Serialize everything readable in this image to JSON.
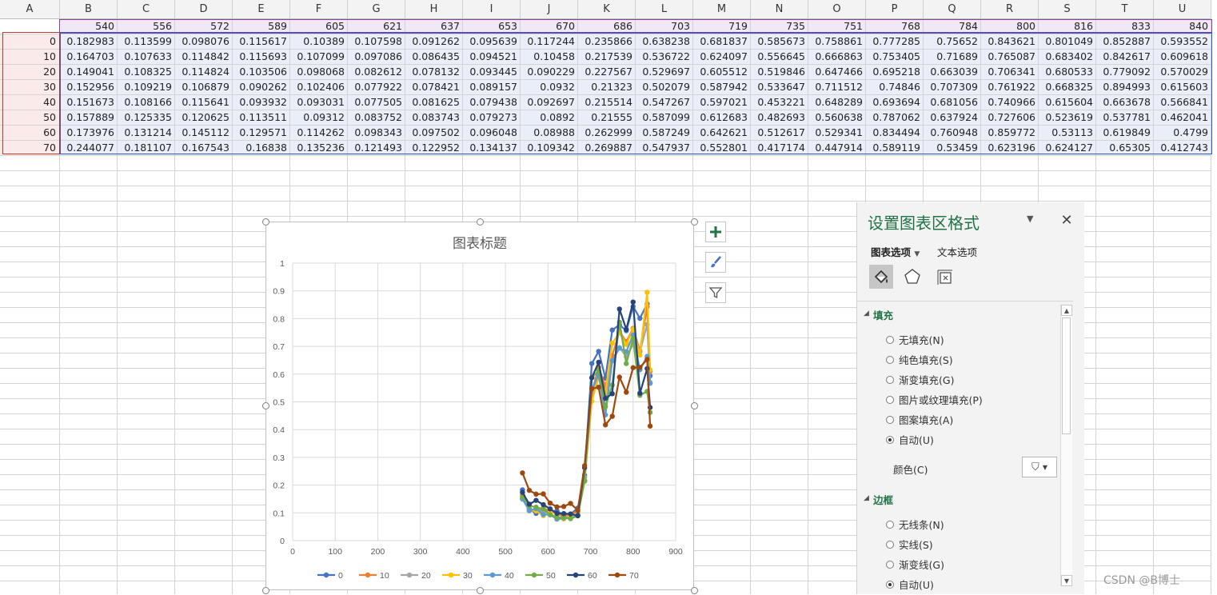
{
  "columns": [
    "A",
    "B",
    "C",
    "D",
    "E",
    "F",
    "G",
    "H",
    "I",
    "J",
    "K",
    "L",
    "M",
    "N",
    "O",
    "P",
    "Q",
    "R",
    "S",
    "T",
    "U"
  ],
  "x_header": [
    "540",
    "556",
    "572",
    "589",
    "605",
    "621",
    "637",
    "653",
    "670",
    "686",
    "703",
    "719",
    "735",
    "751",
    "768",
    "784",
    "800",
    "816",
    "833",
    "840"
  ],
  "rows": [
    {
      "label": "0",
      "values": [
        "0.182983",
        "0.113599",
        "0.098076",
        "0.115617",
        "0.10389",
        "0.107598",
        "0.091262",
        "0.095639",
        "0.117244",
        "0.235866",
        "0.638238",
        "0.681837",
        "0.585673",
        "0.758861",
        "0.777285",
        "0.75652",
        "0.843621",
        "0.801049",
        "0.852887",
        "0.593552"
      ]
    },
    {
      "label": "10",
      "values": [
        "0.164703",
        "0.107633",
        "0.114842",
        "0.115693",
        "0.107099",
        "0.097086",
        "0.086435",
        "0.094521",
        "0.10458",
        "0.217539",
        "0.536722",
        "0.624097",
        "0.556645",
        "0.666863",
        "0.753405",
        "0.71689",
        "0.765087",
        "0.683402",
        "0.842617",
        "0.609618"
      ]
    },
    {
      "label": "20",
      "values": [
        "0.149041",
        "0.108325",
        "0.114824",
        "0.103506",
        "0.098068",
        "0.082612",
        "0.078132",
        "0.093445",
        "0.090229",
        "0.227567",
        "0.529697",
        "0.605512",
        "0.519846",
        "0.647466",
        "0.695218",
        "0.663039",
        "0.706341",
        "0.680533",
        "0.779092",
        "0.570029"
      ]
    },
    {
      "label": "30",
      "values": [
        "0.152956",
        "0.109219",
        "0.106879",
        "0.090262",
        "0.102406",
        "0.077922",
        "0.078421",
        "0.089157",
        "0.0932",
        "0.21323",
        "0.502079",
        "0.587942",
        "0.533647",
        "0.711512",
        "0.74846",
        "0.707309",
        "0.761922",
        "0.668325",
        "0.894993",
        "0.615603"
      ]
    },
    {
      "label": "40",
      "values": [
        "0.151673",
        "0.108166",
        "0.115641",
        "0.093932",
        "0.093031",
        "0.077505",
        "0.081625",
        "0.079438",
        "0.092697",
        "0.215514",
        "0.547267",
        "0.597021",
        "0.453221",
        "0.648289",
        "0.693694",
        "0.681056",
        "0.740966",
        "0.615604",
        "0.663678",
        "0.566841"
      ]
    },
    {
      "label": "50",
      "values": [
        "0.157889",
        "0.125335",
        "0.120625",
        "0.113511",
        "0.09312",
        "0.083752",
        "0.083743",
        "0.079273",
        "0.0892",
        "0.21555",
        "0.587099",
        "0.612683",
        "0.482693",
        "0.560638",
        "0.787062",
        "0.637924",
        "0.727606",
        "0.523619",
        "0.537781",
        "0.462041"
      ]
    },
    {
      "label": "60",
      "values": [
        "0.173976",
        "0.131214",
        "0.145112",
        "0.129571",
        "0.114262",
        "0.098343",
        "0.097502",
        "0.096048",
        "0.08988",
        "0.262999",
        "0.587249",
        "0.642621",
        "0.512617",
        "0.529341",
        "0.834494",
        "0.760948",
        "0.859772",
        "0.53113",
        "0.619849",
        "0.4799"
      ]
    },
    {
      "label": "70",
      "values": [
        "0.244077",
        "0.181107",
        "0.167543",
        "0.16838",
        "0.135236",
        "0.121493",
        "0.122952",
        "0.134137",
        "0.109342",
        "0.269887",
        "0.547937",
        "0.552801",
        "0.417174",
        "0.447914",
        "0.589119",
        "0.53459",
        "0.623196",
        "0.624127",
        "0.65305",
        "0.412743"
      ]
    }
  ],
  "chart_data": {
    "type": "scatter",
    "title": "图表标题",
    "xlim": [
      0,
      900
    ],
    "ylim": [
      0,
      1
    ],
    "xticks": [
      "0",
      "100",
      "200",
      "300",
      "400",
      "500",
      "600",
      "700",
      "800",
      "900"
    ],
    "yticks": [
      "0",
      "0.1",
      "0.2",
      "0.3",
      "0.4",
      "0.5",
      "0.6",
      "0.7",
      "0.8",
      "0.9",
      "1"
    ],
    "x": [
      540,
      556,
      572,
      589,
      605,
      621,
      637,
      653,
      670,
      686,
      703,
      719,
      735,
      751,
      768,
      784,
      800,
      816,
      833,
      840
    ],
    "grid": true,
    "legend_position": "bottom",
    "series": [
      {
        "name": "0",
        "color": "#4472c4",
        "values": [
          0.182983,
          0.113599,
          0.098076,
          0.115617,
          0.10389,
          0.107598,
          0.091262,
          0.095639,
          0.117244,
          0.235866,
          0.638238,
          0.681837,
          0.585673,
          0.758861,
          0.777285,
          0.75652,
          0.843621,
          0.801049,
          0.852887,
          0.593552
        ]
      },
      {
        "name": "10",
        "color": "#ed7d31",
        "values": [
          0.164703,
          0.107633,
          0.114842,
          0.115693,
          0.107099,
          0.097086,
          0.086435,
          0.094521,
          0.10458,
          0.217539,
          0.536722,
          0.624097,
          0.556645,
          0.666863,
          0.753405,
          0.71689,
          0.765087,
          0.683402,
          0.842617,
          0.609618
        ]
      },
      {
        "name": "20",
        "color": "#a5a5a5",
        "values": [
          0.149041,
          0.108325,
          0.114824,
          0.103506,
          0.098068,
          0.082612,
          0.078132,
          0.093445,
          0.090229,
          0.227567,
          0.529697,
          0.605512,
          0.519846,
          0.647466,
          0.695218,
          0.663039,
          0.706341,
          0.680533,
          0.779092,
          0.570029
        ]
      },
      {
        "name": "30",
        "color": "#ffc000",
        "values": [
          0.152956,
          0.109219,
          0.106879,
          0.090262,
          0.102406,
          0.077922,
          0.078421,
          0.089157,
          0.0932,
          0.21323,
          0.502079,
          0.587942,
          0.533647,
          0.711512,
          0.74846,
          0.707309,
          0.761922,
          0.668325,
          0.894993,
          0.615603
        ]
      },
      {
        "name": "40",
        "color": "#5b9bd5",
        "values": [
          0.151673,
          0.108166,
          0.115641,
          0.093932,
          0.093031,
          0.077505,
          0.081625,
          0.079438,
          0.092697,
          0.215514,
          0.547267,
          0.597021,
          0.453221,
          0.648289,
          0.693694,
          0.681056,
          0.740966,
          0.615604,
          0.663678,
          0.566841
        ]
      },
      {
        "name": "50",
        "color": "#70ad47",
        "values": [
          0.157889,
          0.125335,
          0.120625,
          0.113511,
          0.09312,
          0.083752,
          0.083743,
          0.079273,
          0.0892,
          0.21555,
          0.587099,
          0.612683,
          0.482693,
          0.560638,
          0.787062,
          0.637924,
          0.727606,
          0.523619,
          0.537781,
          0.462041
        ]
      },
      {
        "name": "60",
        "color": "#264478",
        "values": [
          0.173976,
          0.131214,
          0.145112,
          0.129571,
          0.114262,
          0.098343,
          0.097502,
          0.096048,
          0.08988,
          0.262999,
          0.587249,
          0.642621,
          0.512617,
          0.529341,
          0.834494,
          0.760948,
          0.859772,
          0.53113,
          0.619849,
          0.4799
        ]
      },
      {
        "name": "70",
        "color": "#9e480e",
        "values": [
          0.244077,
          0.181107,
          0.167543,
          0.16838,
          0.135236,
          0.121493,
          0.122952,
          0.134137,
          0.109342,
          0.269887,
          0.547937,
          0.552801,
          0.417174,
          0.447914,
          0.589119,
          0.53459,
          0.623196,
          0.624127,
          0.65305,
          0.412743
        ]
      }
    ]
  },
  "chart_side_buttons": {
    "add": "plus-icon",
    "style": "brush-icon",
    "filter": "filter-icon"
  },
  "pane": {
    "title": "设置图表区格式",
    "tab_chart_options": "图表选项",
    "tab_text_options": "文本选项",
    "icons": [
      "fill-line-icon",
      "effects-icon",
      "size-properties-icon"
    ],
    "fill_section": "填充",
    "fill_options": [
      "无填充(N)",
      "纯色填充(S)",
      "渐变填充(G)",
      "图片或纹理填充(P)",
      "图案填充(A)",
      "自动(U)"
    ],
    "fill_selected": "自动(U)",
    "color_label": "颜色(C)",
    "border_section": "边框",
    "border_options": [
      "无线条(N)",
      "实线(S)",
      "渐变线(G)",
      "自动(U)"
    ],
    "border_selected": "自动(U)"
  },
  "watermark": "CSDN @B博士"
}
